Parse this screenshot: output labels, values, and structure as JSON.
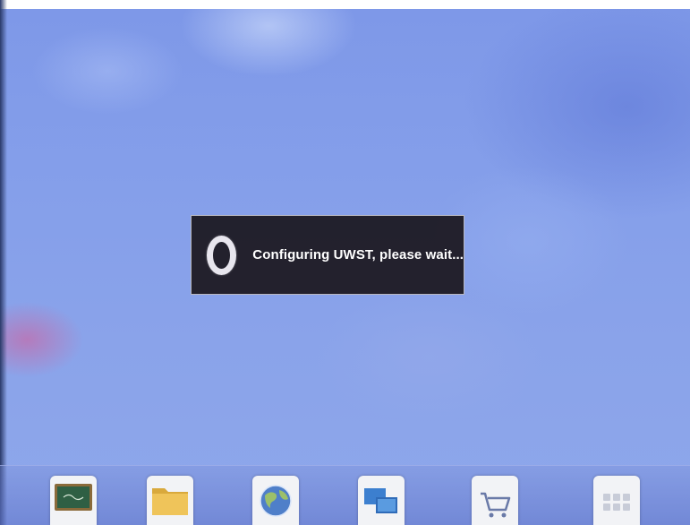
{
  "screen": {
    "background_color": "#859fea"
  },
  "dialog": {
    "message": "Configuring UWST, please wait...",
    "spinner_icon": "loading-spinner-icon",
    "background_color": "#1a161c"
  },
  "dock": {
    "items": [
      {
        "name": "whiteboard-app",
        "icon": "chalkboard-icon"
      },
      {
        "name": "file-manager",
        "icon": "folder-icon"
      },
      {
        "name": "browser",
        "icon": "globe-icon"
      },
      {
        "name": "screen-share",
        "icon": "display-share-icon"
      },
      {
        "name": "app-store",
        "icon": "shopping-cart-icon"
      },
      {
        "name": "more-apps",
        "icon": "app-grid-icon"
      }
    ]
  }
}
